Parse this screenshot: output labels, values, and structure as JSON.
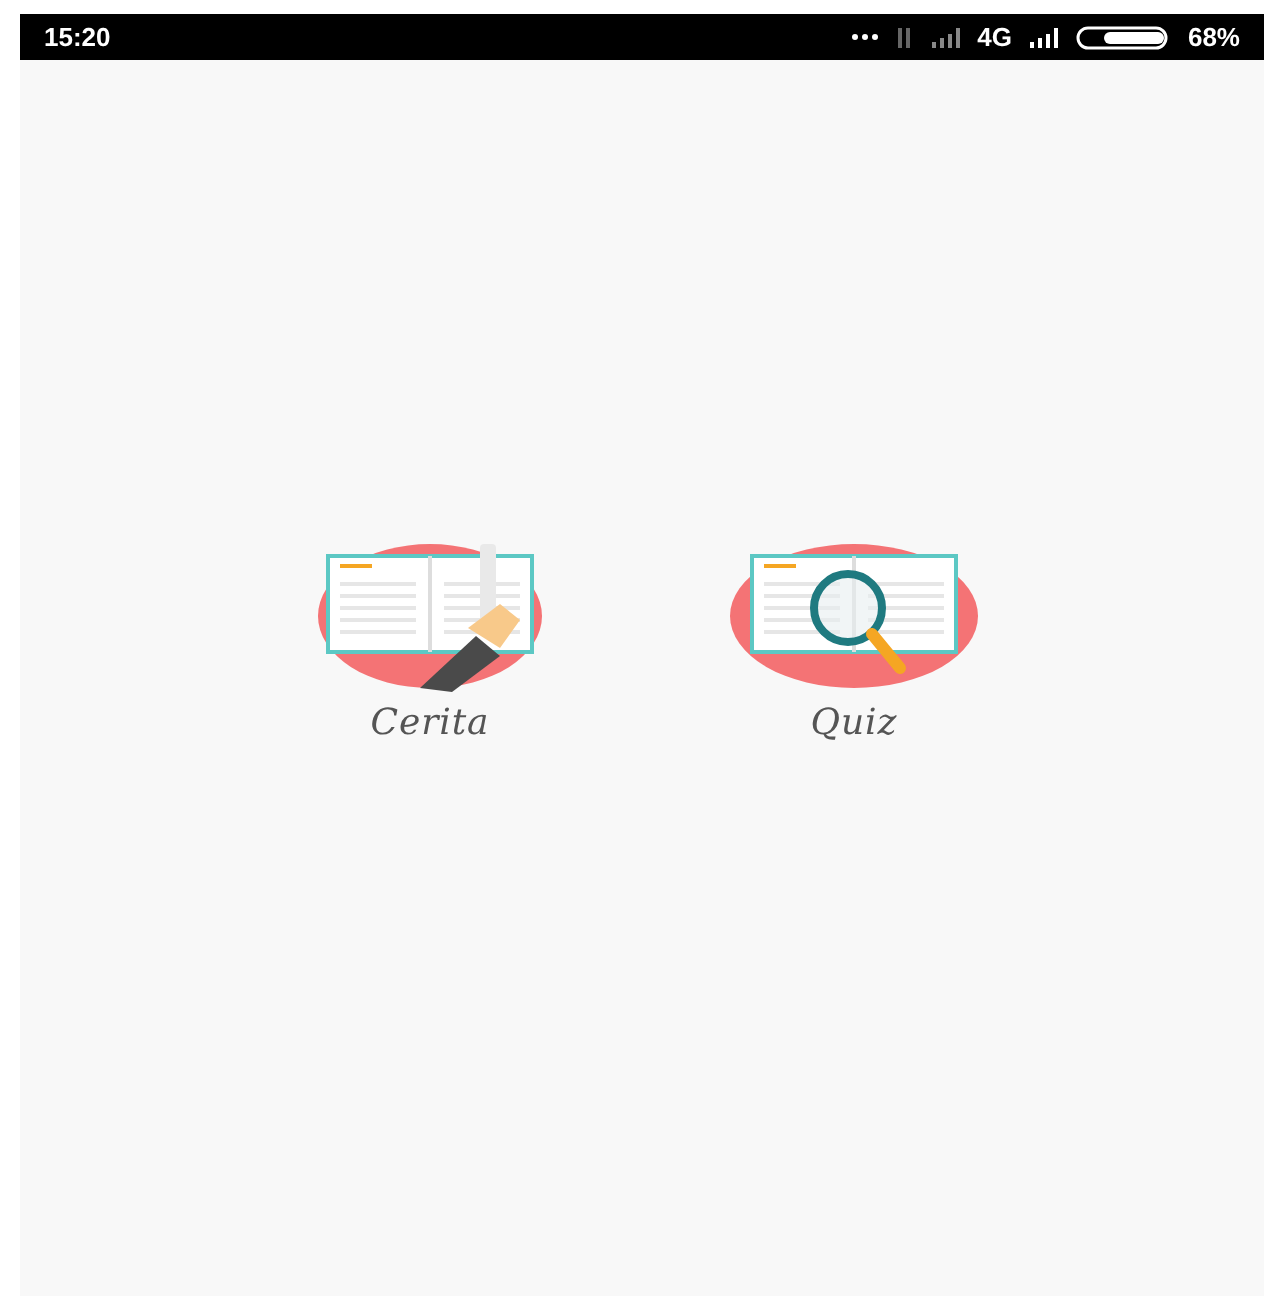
{
  "status_bar": {
    "time": "15:20",
    "network": "4G",
    "battery": "68%"
  },
  "menu": [
    {
      "label": "Cerita",
      "kind": "reading"
    },
    {
      "label": "Quiz",
      "kind": "quiz"
    }
  ]
}
